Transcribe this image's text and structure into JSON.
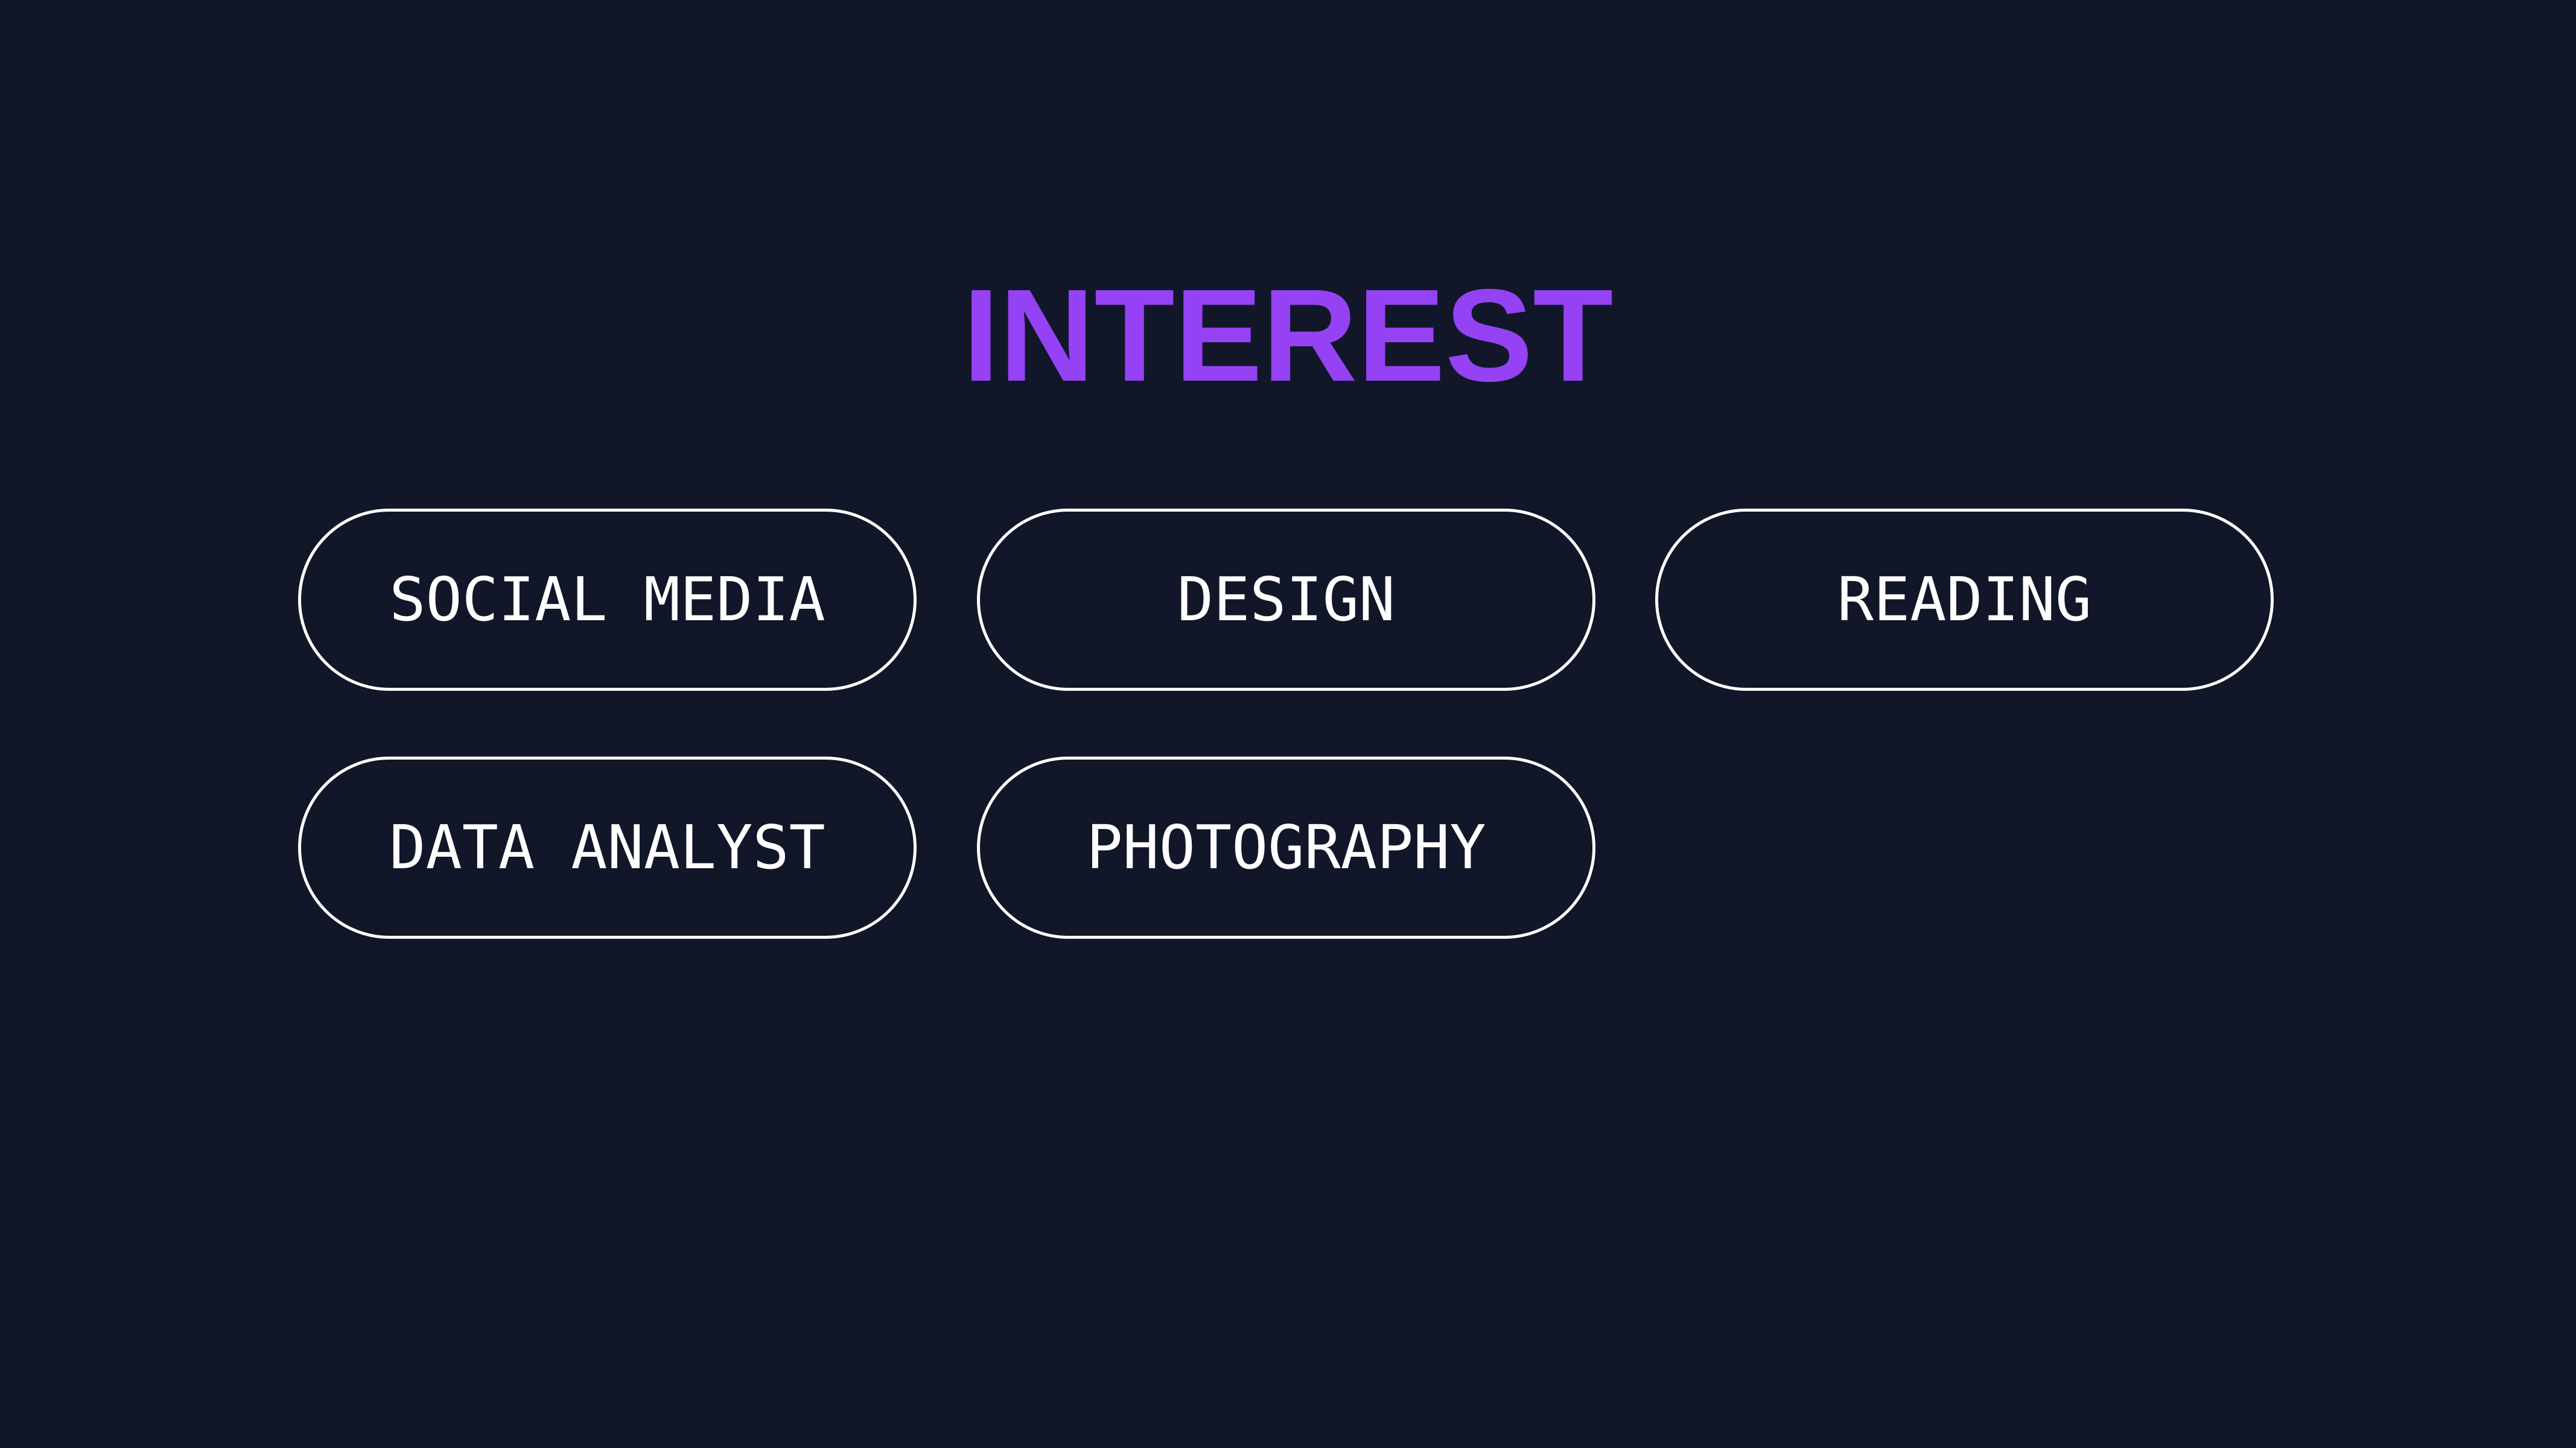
{
  "title": "INTEREST",
  "colors": {
    "background": "#111728",
    "accent": "#9442F4",
    "pill_border": "#ffffff",
    "pill_text": "#ffffff"
  },
  "interests": [
    {
      "label": "SOCIAL MEDIA"
    },
    {
      "label": "DESIGN"
    },
    {
      "label": "READING"
    },
    {
      "label": "DATA ANALYST"
    },
    {
      "label": "PHOTOGRAPHY"
    }
  ]
}
